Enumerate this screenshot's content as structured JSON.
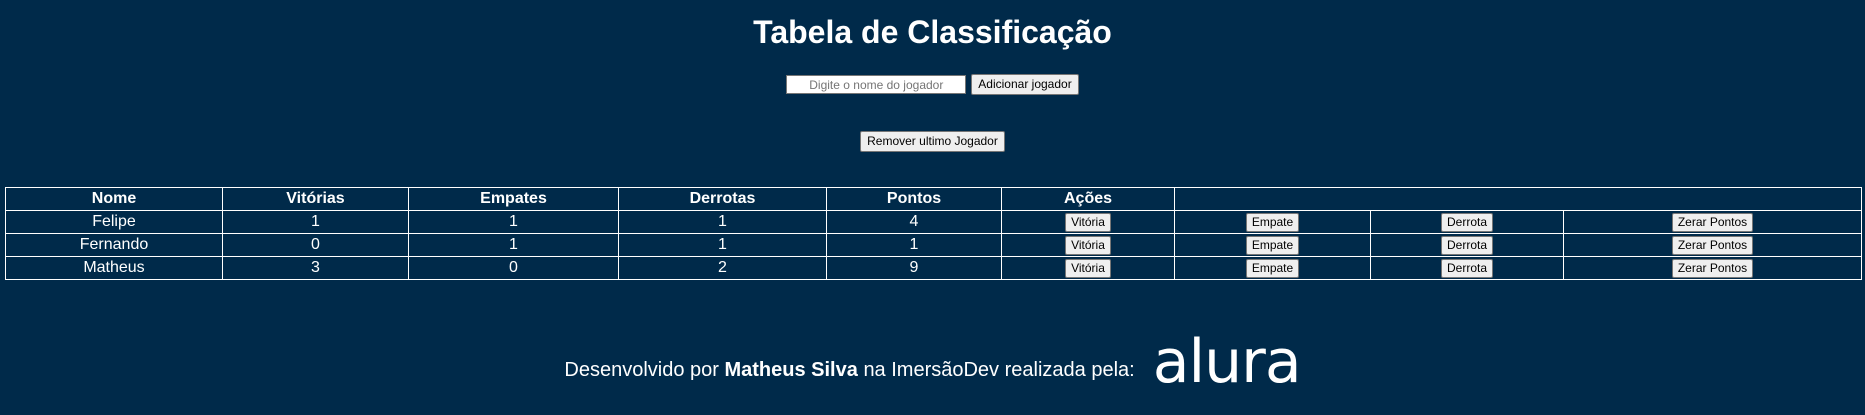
{
  "header": {
    "title": "Tabela de Classificação"
  },
  "add_player": {
    "input_placeholder": "Digite o nome do jogador",
    "input_value": "",
    "add_button": "Adicionar jogador"
  },
  "remove_button": "Remover ultimo Jogador",
  "table": {
    "columns": [
      "Nome",
      "Vitórias",
      "Empates",
      "Derrotas",
      "Pontos",
      "Ações"
    ],
    "rows": [
      {
        "name": "Felipe",
        "wins": "1",
        "draws": "1",
        "losses": "1",
        "points": "4"
      },
      {
        "name": "Fernando",
        "wins": "0",
        "draws": "1",
        "losses": "1",
        "points": "1"
      },
      {
        "name": "Matheus",
        "wins": "3",
        "draws": "0",
        "losses": "2",
        "points": "9"
      }
    ],
    "actions": {
      "win": "Vitória",
      "draw": "Empate",
      "loss": "Derrota",
      "reset": "Zerar Pontos"
    }
  },
  "footer": {
    "prefix": "Desenvolvido por",
    "author": "Matheus Silva",
    "suffix": "na ImersãoDev realizada pela:",
    "logo_text": "alura"
  },
  "colors": {
    "background": "#002a4a",
    "text": "#ffffff",
    "border": "#ffffff"
  }
}
